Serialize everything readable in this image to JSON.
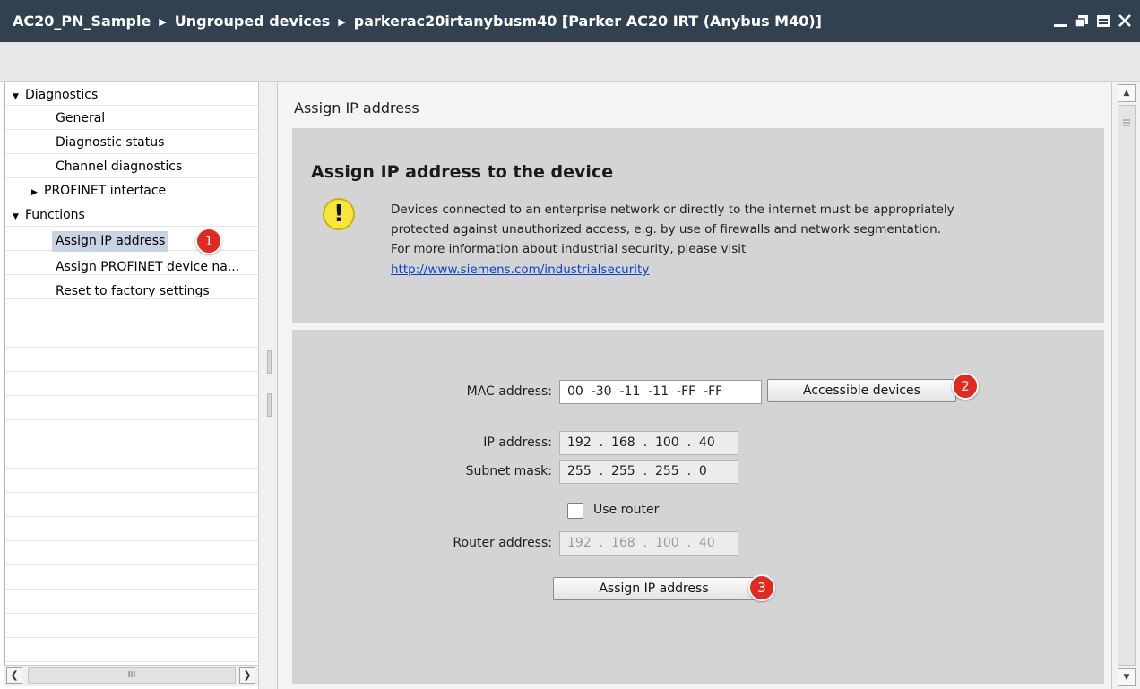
{
  "titlebar": {
    "crumbs": [
      "AC20_PN_Sample",
      "Ungrouped devices",
      "parkerac20irtanybusm40 [Parker AC20 IRT (Anybus M40)]"
    ],
    "separator": "▶",
    "background": "#31414f"
  },
  "window_controls": [
    "minimize-icon",
    "restore-icon",
    "maximize-icon",
    "close-icon"
  ],
  "nav": {
    "diagnostics": "Diagnostics",
    "general": "General",
    "diagnostic_status": "Diagnostic status",
    "channel_diagnostics": "Channel diagnostics",
    "profinet_interface": "PROFINET interface",
    "functions": "Functions",
    "assign_ip": "Assign IP address",
    "assign_profinet": "Assign PROFINET device na...",
    "reset_factory": "Reset to factory settings",
    "selected_background": "#c8d3e3"
  },
  "main": {
    "section_title": "Assign IP address",
    "heading": "Assign IP address to the device",
    "warning_lines": [
      "Devices connected to an enterprise network or directly to the internet must be appropriately",
      "protected against unauthorized access, e.g. by use of firewalls and network segmentation.",
      "For more information about industrial security, please visit"
    ],
    "link": "http://www.siemens.com/industrialsecurity",
    "link_color": "#0a3fd0",
    "warning_icon": "warning-icon",
    "warning_glyph": "!"
  },
  "form": {
    "mac_label": "MAC address:",
    "mac_value": "00  -30  -11  -11  -FF  -FF",
    "accessible_button": "Accessible devices",
    "ip_label": "IP address:",
    "ip_value": "192  .  168  .  100  .  40",
    "subnet_label": "Subnet mask:",
    "subnet_value": "255  .  255  .  255  .  0",
    "use_router_label": "Use router",
    "use_router_checked": false,
    "router_label": "Router address:",
    "router_value": "192  .  168  .  100  .  40",
    "assign_button": "Assign IP address"
  },
  "badges": {
    "one": "1",
    "two": "2",
    "three": "3",
    "color": "#e02a20"
  },
  "scroll": {
    "h_thumb_grip": "III"
  }
}
